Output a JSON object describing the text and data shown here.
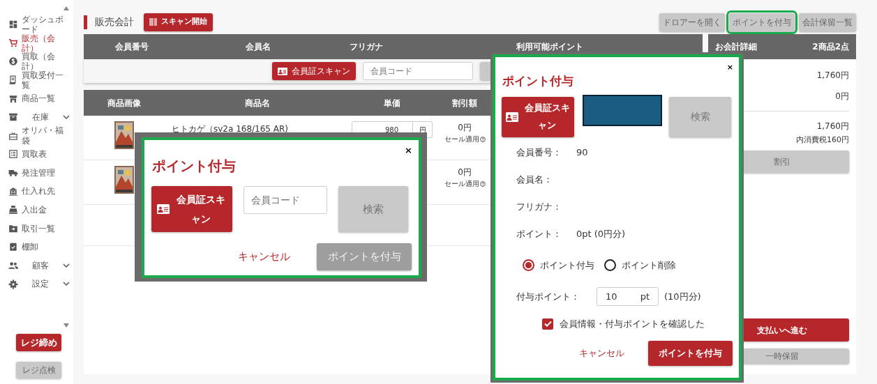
{
  "sidebar": {
    "items": [
      {
        "label": "ダッシュボード",
        "selected": false,
        "expandable": false
      },
      {
        "label": "販売（会計）",
        "selected": true,
        "expandable": false
      },
      {
        "label": "買取（会計）",
        "selected": false,
        "expandable": false
      },
      {
        "label": "買取受付一覧",
        "selected": false,
        "expandable": false
      },
      {
        "label": "商品一覧",
        "selected": false,
        "expandable": false
      },
      {
        "label": "在庫",
        "selected": false,
        "expandable": true
      },
      {
        "label": "オリパ・福袋",
        "selected": false,
        "expandable": false
      },
      {
        "label": "買取表",
        "selected": false,
        "expandable": false
      },
      {
        "label": "発注管理",
        "selected": false,
        "expandable": false
      },
      {
        "label": "仕入れ先",
        "selected": false,
        "expandable": false
      },
      {
        "label": "入出金",
        "selected": false,
        "expandable": false
      },
      {
        "label": "取引一覧",
        "selected": false,
        "expandable": false
      },
      {
        "label": "棚卸",
        "selected": false,
        "expandable": false
      },
      {
        "label": "顧客",
        "selected": false,
        "expandable": true
      },
      {
        "label": "設定",
        "selected": false,
        "expandable": true
      }
    ],
    "close_button": "レジ締め",
    "check_button": "レジ点検"
  },
  "header": {
    "title": "販売会計",
    "scan_button": "スキャン開始",
    "actions": [
      {
        "label": "ドロアーを開く",
        "highlighted": false
      },
      {
        "label": "ポイントを付与",
        "highlighted": true
      },
      {
        "label": "会計保留一覧",
        "highlighted": false
      }
    ]
  },
  "member_table": {
    "columns": [
      "会員番号",
      "会員名",
      "フリガナ",
      "利用可能ポイント"
    ],
    "scan_button": "会員証スキャン",
    "code_field": {
      "placeholder": "会員コード"
    }
  },
  "product_table": {
    "columns": [
      "商品画像",
      "商品名",
      "単価",
      "割引額"
    ],
    "rows": [
      {
        "kind": "picture",
        "name": "ヒトカゲ（sv2a 168/165 AR)",
        "price": "980",
        "unit": "円",
        "discount": "0円",
        "sale_note": "セール適用"
      },
      {
        "kind": "picture",
        "discount": "0円",
        "sale_note": "セール適用"
      }
    ]
  },
  "summary": {
    "title": "お会計詳細",
    "count": "2商品2点",
    "lines": [
      "1,760円",
      "0円"
    ],
    "total": "1,760円",
    "tax_note": "内消費税160円",
    "discount_button": "割引",
    "pay_button": "支払いへ進む",
    "hold_button": "一時保留"
  },
  "dialog_small": {
    "highlighted": true,
    "title": "ポイント付与",
    "close": "×",
    "scan_button": "会員証スキャン",
    "code_field": {
      "placeholder": "会員コード"
    },
    "search_button": {
      "label": "検索",
      "disabled": true
    },
    "cancel": "キャンセル",
    "submit": {
      "label": "ポイントを付与",
      "disabled": true
    }
  },
  "dialog_points": {
    "highlighted": true,
    "title": "ポイント付与",
    "close": "×",
    "scan_button": "会員証スキャン",
    "search_button": {
      "label": "検索",
      "disabled": true
    },
    "info": [
      {
        "label": "会員番号：",
        "value": "90"
      },
      {
        "label": "会員名："
      },
      {
        "label": "フリガナ："
      },
      {
        "label": "ポイント：",
        "value": "0pt (0円分)"
      }
    ],
    "modes": [
      {
        "label": "ポイント付与",
        "selected": true
      },
      {
        "label": "ポイント削除",
        "selected": false
      }
    ],
    "amount": {
      "label": "付与ポイント：",
      "value": "10",
      "unit": "pt",
      "note": "(10円分)"
    },
    "confirm": {
      "label": "会員情報・付与ポイントを確認した",
      "checked": true
    },
    "cancel": "キャンセル",
    "submit": {
      "label": "ポイントを付与",
      "disabled": false
    }
  }
}
